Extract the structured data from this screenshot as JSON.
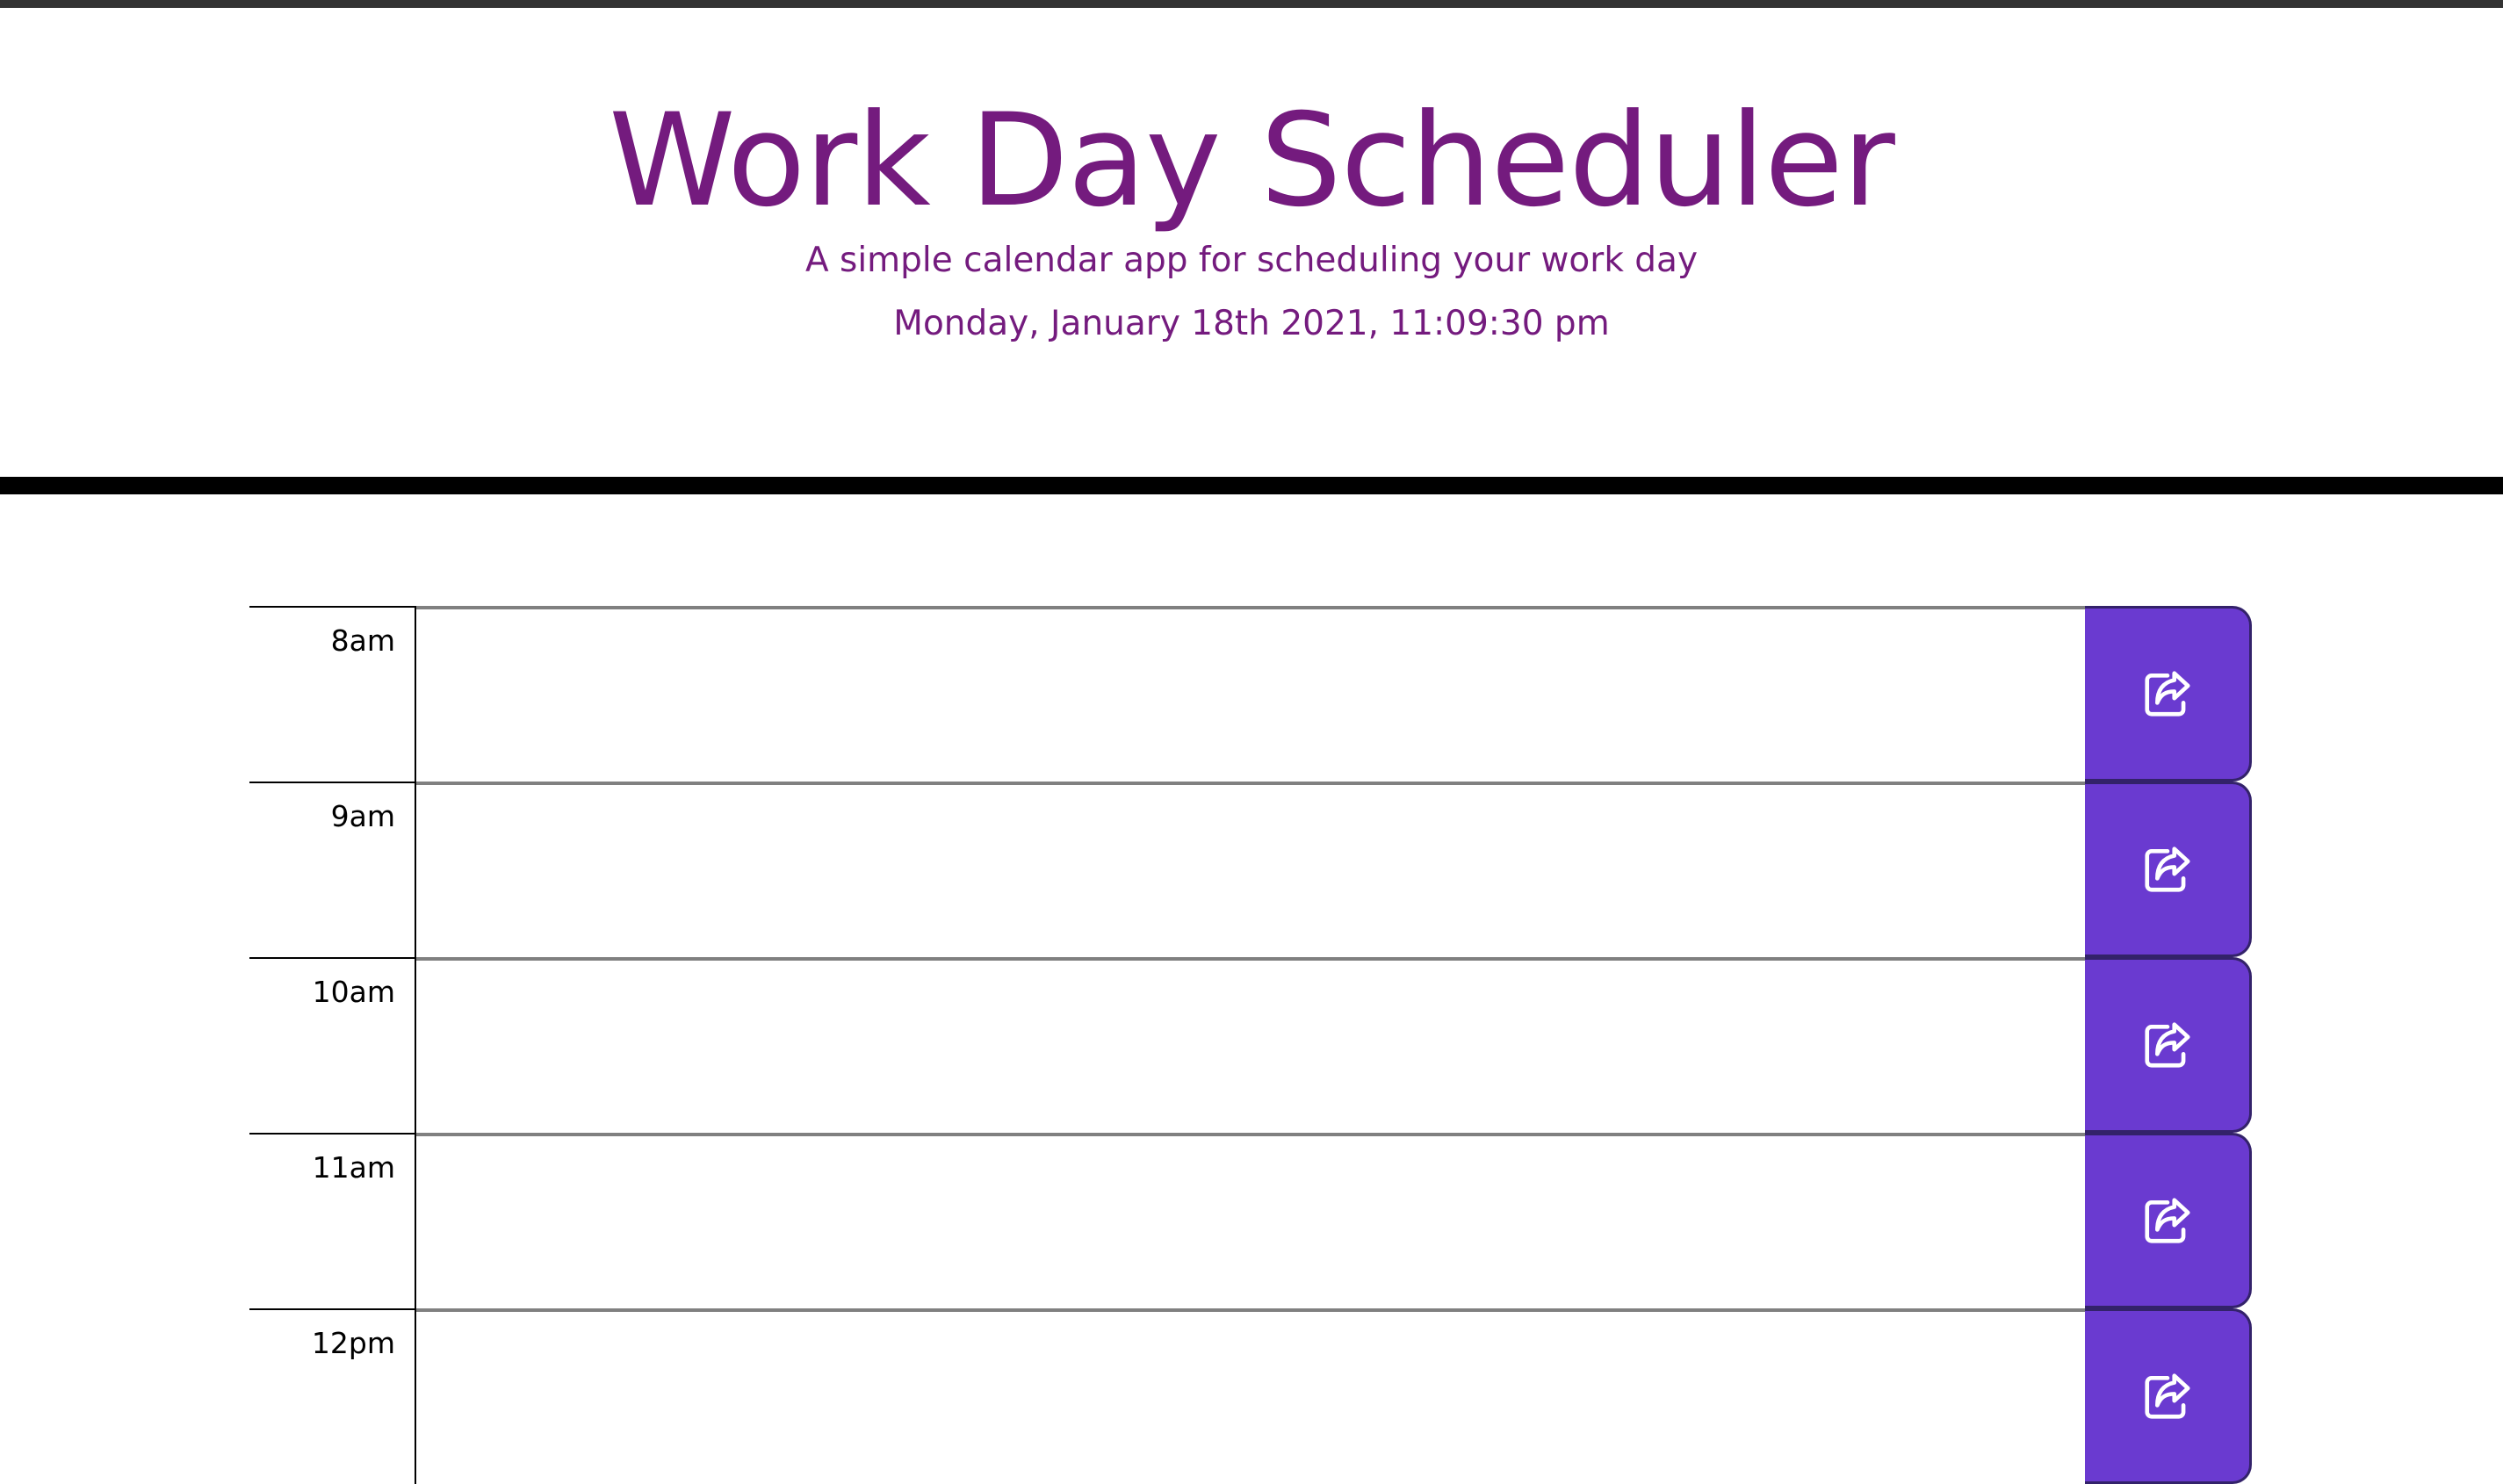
{
  "header": {
    "title": "Work Day Scheduler",
    "subtitle": "A simple calendar app for scheduling your work day",
    "current_day": "Monday, January 18th 2021, 11:09:30 pm"
  },
  "time_blocks": [
    {
      "hour": "8am",
      "description": ""
    },
    {
      "hour": "9am",
      "description": ""
    },
    {
      "hour": "10am",
      "description": ""
    },
    {
      "hour": "11am",
      "description": ""
    },
    {
      "hour": "12pm",
      "description": ""
    }
  ],
  "save_button": {
    "icon": "save-share-icon"
  },
  "colors": {
    "title": "#741b7e",
    "save_button": "#6a3ad0",
    "header_border": "#000000"
  }
}
